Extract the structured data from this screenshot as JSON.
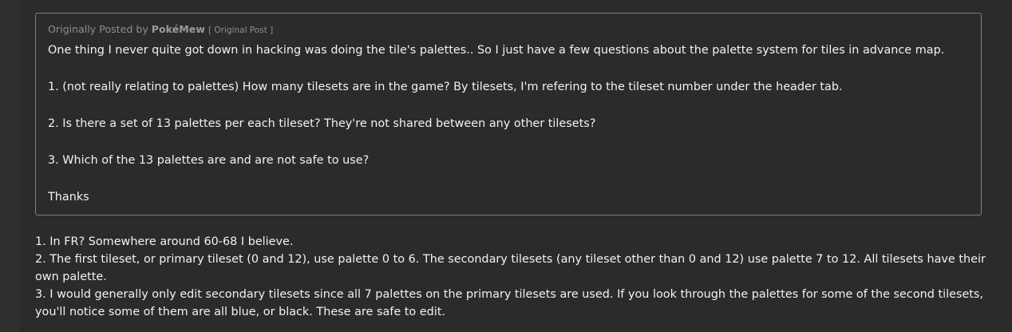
{
  "quote": {
    "prefix": "Originally Posted by",
    "author": "PokéMew",
    "original_post_link": "[ Original Post ]",
    "lines": [
      "One thing I never quite got down in hacking was doing the tile's palettes.. So I just have a few questions about the palette system for tiles in advance map.",
      "1. (not really relating to palettes) How many tilesets are in the game? By tilesets, I'm refering to the tileset number under the header tab.",
      "2. Is there a set of 13 palettes per each tileset? They're not shared between any other tilesets?",
      "3. Which of the 13 palettes are and are not safe to use?",
      "Thanks"
    ]
  },
  "reply": {
    "lines": [
      "1. In FR? Somewhere around 60-68 I believe.",
      "2. The first tileset, or primary tileset (0 and 12), use palette 0 to 6. The secondary tilesets (any tileset other than 0 and 12) use palette 7 to 12. All tilesets have their own palette.",
      "3. I would generally only edit secondary tilesets since all 7 palettes on the primary tilesets are used. If you look through the palettes for some of the second tilesets, you'll notice some of them are all blue, or black. These are safe to edit."
    ]
  },
  "colors": {
    "background": "#2b2b2b",
    "quote_border": "#808080",
    "text": "#f2f2f2",
    "muted_text": "#8f8f8f"
  }
}
